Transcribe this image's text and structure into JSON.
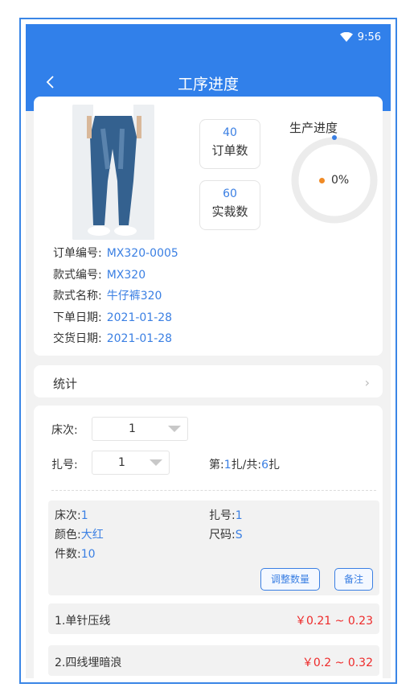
{
  "status": {
    "time": "9:56",
    "wifi_icon": "wifi-icon"
  },
  "header": {
    "title": "工序进度",
    "back_icon": "back-chevron-icon"
  },
  "order": {
    "stat_boxes": [
      {
        "value": "40",
        "label": "订单数"
      },
      {
        "value": "60",
        "label": "实裁数"
      }
    ],
    "progress": {
      "title": "生产进度",
      "percent_text": "0%",
      "value": 0
    },
    "fields": [
      {
        "label": "订单编号:",
        "value": "MX320-0005"
      },
      {
        "label": "款式编号:",
        "value": "MX320"
      },
      {
        "label": "款式名称:",
        "value": "牛仔裤320"
      },
      {
        "label": "下单日期:",
        "value": "2021-01-28"
      },
      {
        "label": "交货日期:",
        "value": "2021-01-28"
      }
    ]
  },
  "stats_row": {
    "label": "统计",
    "chevron_icon": "chevron-right-icon"
  },
  "filters": {
    "bed_label": "床次:",
    "bed_value": "1",
    "bundle_label": "扎号:",
    "bundle_value": "1",
    "bundle_prefix": "第:",
    "bundle_current": "1",
    "bundle_mid": "扎/共:",
    "bundle_total": "6",
    "bundle_suffix": "扎"
  },
  "detail": {
    "bed_label": "床次:",
    "bed_value": "1",
    "bundle_label": "扎号:",
    "bundle_value": "1",
    "color_label": "颜色:",
    "color_value": "大红",
    "size_label": "尺码:",
    "size_value": "S",
    "qty_label": "件数:",
    "qty_value": "10",
    "adjust_button": "调整数量",
    "note_button": "备注"
  },
  "processes": [
    {
      "name": "1.单针压线",
      "price": "￥0.21 ~ 0.23"
    },
    {
      "name": "2.四线埋暗浪",
      "price": "￥0.2 ~ 0.32"
    }
  ],
  "colors": {
    "primary": "#3180ea",
    "accent_blue": "#3a7fe3",
    "price_red": "#ee2a2a",
    "progress_orange": "#f08a25"
  }
}
